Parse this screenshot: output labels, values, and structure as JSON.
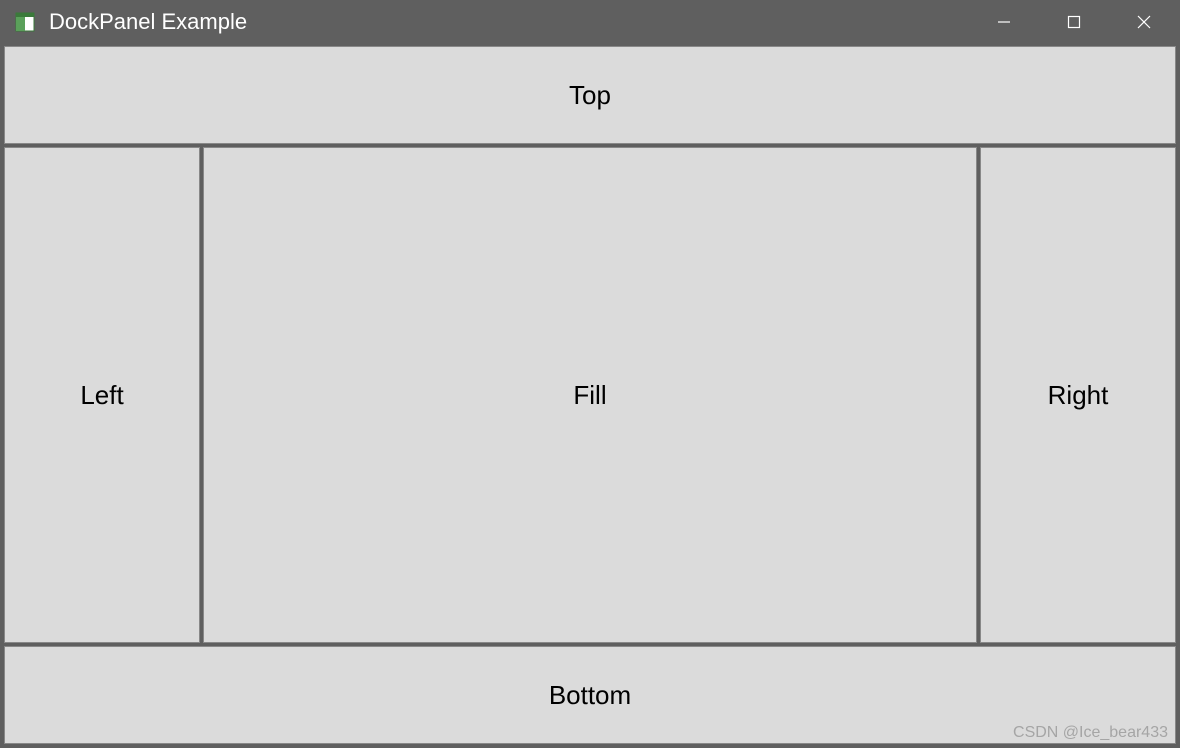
{
  "window": {
    "title": "DockPanel Example"
  },
  "panels": {
    "top": "Top",
    "left": "Left",
    "fill": "Fill",
    "right": "Right",
    "bottom": "Bottom"
  },
  "watermark": "CSDN @Ice_bear433"
}
